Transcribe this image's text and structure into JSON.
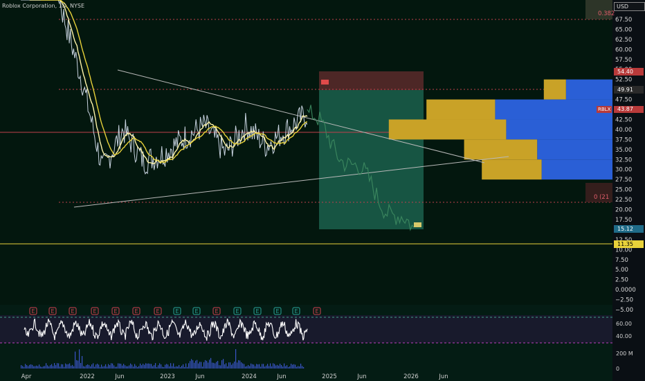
{
  "header": {
    "symbol_label": "Roblox Corporation, 1D, NYSE"
  },
  "currency": "USD",
  "price_axis": {
    "ticks": [
      "67.50",
      "65.00",
      "62.50",
      "60.00",
      "57.50",
      "55.00",
      "52.50",
      "50.00",
      "47.50",
      "45.00",
      "42.50",
      "40.00",
      "37.50",
      "35.00",
      "32.50",
      "30.00",
      "27.50",
      "25.00",
      "22.50",
      "20.00",
      "17.50",
      "15.00",
      "12.50",
      "10.00",
      "7.50",
      "5.00",
      "2.50",
      "0.0000",
      "−2.50",
      "−5.00"
    ],
    "labels": {
      "fib_top": "0.382",
      "target_high": "54.40",
      "stop": "49.91",
      "ticker": "RBLX",
      "last_price": "43.87",
      "fib_bottom": "0 (21",
      "target_low": "15.12",
      "support": "11.35"
    }
  },
  "time_axis": [
    "Apr",
    "2022",
    "Jun",
    "2023",
    "Jun",
    "2024",
    "Jun",
    "2025",
    "Jun",
    "2026",
    "Jun"
  ],
  "indicator_axis": {
    "rsi_ticks": [
      "60.00",
      "40.00"
    ],
    "volume_tick": "200 M",
    "volume_zero": "0"
  },
  "event_markers": [
    "E",
    "E",
    "E",
    "E",
    "E",
    "E",
    "E",
    "E",
    "E",
    "E",
    "E",
    "E",
    "E",
    "E",
    "E",
    "E"
  ],
  "colors": {
    "price": "#c8d3e0",
    "ma_fast": "#fff4a8",
    "ma_slow": "#e8d23a",
    "stop_zone": "#5a2a2a",
    "target_zone": "#1f6b55",
    "vp_gold": "#c9a227",
    "vp_blue": "#2a5fd6",
    "support": "#e8d23a",
    "rsi": "#ffffff"
  },
  "chart_data": {
    "type": "line",
    "title": "Roblox Corporation, 1D, NYSE",
    "y_range": [
      -5,
      70
    ],
    "x": [
      "2021-04",
      "2021-07",
      "2021-10",
      "2022-01",
      "2022-04",
      "2022-07",
      "2022-10",
      "2023-01",
      "2023-04",
      "2023-07",
      "2023-10",
      "2024-01",
      "2024-04",
      "2024-07",
      "2024-09"
    ],
    "series": [
      {
        "values": [
          95,
          100,
          70,
          52,
          30,
          40,
          32,
          34,
          38,
          41,
          34,
          41,
          36,
          40,
          43.87
        ]
      }
    ],
    "projection": {
      "start": 43.87,
      "end": 13.5
    },
    "position": {
      "entry": 49.91,
      "stop": 54.4,
      "target": 15.12
    },
    "levels": {
      "horizontal": [
        11.35,
        39.0,
        22.0,
        49.91,
        67.5
      ]
    },
    "volume_profile_rows": [
      {
        "price_low": 47.5,
        "price_high": 52.5,
        "up": 1,
        "down": 2.1
      },
      {
        "price_low": 42.5,
        "price_high": 47.5,
        "up": 3.1,
        "down": 5.3
      },
      {
        "price_low": 37.5,
        "price_high": 42.5,
        "up": 5.3,
        "down": 4.8
      },
      {
        "price_low": 32.5,
        "price_high": 37.5,
        "up": 3.3,
        "down": 3.4
      },
      {
        "price_low": 27.5,
        "price_high": 32.5,
        "up": 2.7,
        "down": 3.2
      }
    ]
  }
}
